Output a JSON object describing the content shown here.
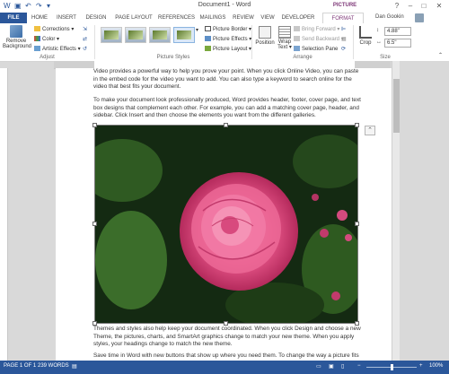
{
  "titlebar": {
    "title": "Document1 - Word",
    "picture_tools": "PICTURE TOOLS",
    "help": "?",
    "minimize": "–",
    "restore": "□",
    "close": "✕"
  },
  "tabs": [
    "FILE",
    "HOME",
    "INSERT",
    "DESIGN",
    "PAGE LAYOUT",
    "REFERENCES",
    "MAILINGS",
    "REVIEW",
    "VIEW",
    "DEVELOPER",
    "FORMAT"
  ],
  "user": {
    "name": "Dan Gookin"
  },
  "ribbon": {
    "remove_background": "Remove Background",
    "adjust": {
      "corrections": "Corrections ▾",
      "color": "Color ▾",
      "artistic": "Artistic Effects ▾",
      "label": "Adjust"
    },
    "styles": {
      "border": "Picture Border ▾",
      "effects": "Picture Effects ▾",
      "layout": "Picture Layout ▾",
      "label": "Picture Styles"
    },
    "arrange": {
      "position": "Position",
      "wrap": "Wrap Text ▾",
      "bring": "Bring Forward ▾",
      "send": "Send Backward ▾",
      "pane": "Selection Pane",
      "label": "Arrange"
    },
    "size": {
      "crop": "Crop",
      "height": "4.88\"",
      "width": "6.5\"",
      "label": "Size"
    }
  },
  "doc": {
    "p1": "Video provides a powerful way to help you prove your point. When you click Online Video, you can paste in the embed code for the video you want to add. You can also type a keyword to search online for the video that best fits your document.",
    "p2": "To make your document look professionally produced, Word provides header, footer, cover page, and text box designs that complement each other. For example, you can add a matching cover page, header, and sidebar. Click Insert and then choose the elements you want from the different galleries.",
    "p3": "Themes and styles also help keep your document coordinated. When you click Design and choose a new Theme, the pictures, charts, and SmartArt graphics change to match your new theme. When you apply styles, your headings change to match the new theme.",
    "p4": "Save time in Word with new buttons that show up where you need them. To change the way a picture fits in your document, click it and a button for layout options appears next to it. When you work on a"
  },
  "status": {
    "page": "PAGE 1 OF 1",
    "words": "239 WORDS",
    "zoom": "100%",
    "zoom_level": 0.5
  },
  "colors": {
    "accent": "#2b579a",
    "picture_tools": "#7e3878"
  }
}
